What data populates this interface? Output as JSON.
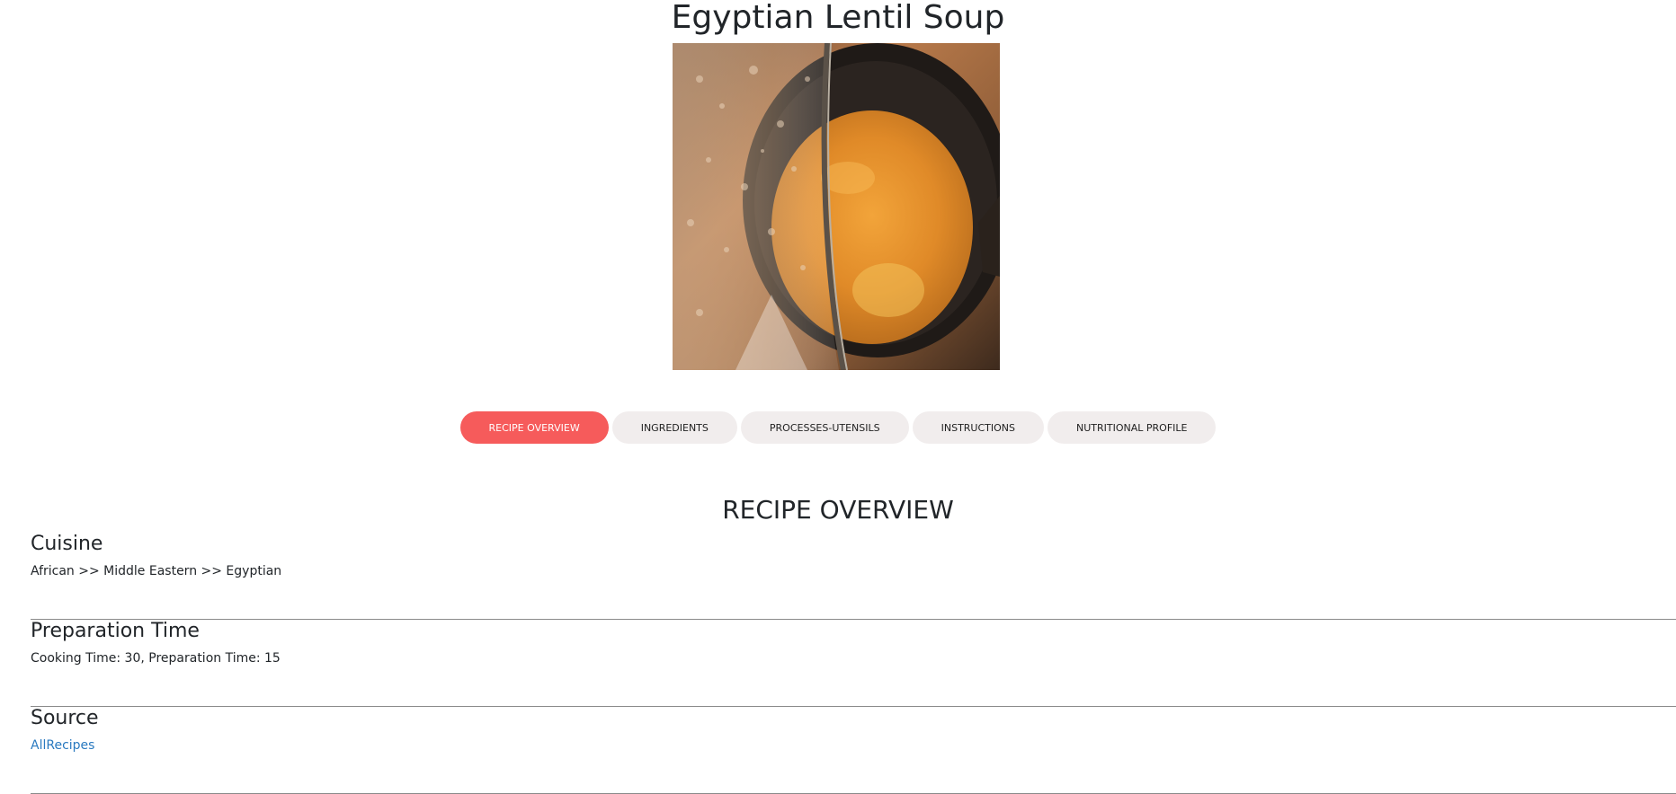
{
  "recipe": {
    "title": "Egyptian Lentil Soup",
    "image_alt": "Egyptian Lentil Soup"
  },
  "tabs": [
    {
      "label": "RECIPE OVERVIEW",
      "active": true
    },
    {
      "label": "INGREDIENTS",
      "active": false
    },
    {
      "label": "PROCESSES-UTENSILS",
      "active": false
    },
    {
      "label": "INSTRUCTIONS",
      "active": false
    },
    {
      "label": "NUTRITIONAL PROFILE",
      "active": false
    }
  ],
  "overview": {
    "title": "RECIPE OVERVIEW",
    "cuisine": {
      "heading": "Cuisine",
      "value": "African >> Middle Eastern >> Egyptian"
    },
    "prep_time": {
      "heading": "Preparation Time",
      "value": "Cooking Time: 30, Preparation Time: 15"
    },
    "source": {
      "heading": "Source",
      "link_text": "AllRecipes"
    }
  },
  "colors": {
    "active_tab": "#f65b5b",
    "inactive_tab": "#f1eded",
    "link": "#2a7ac0"
  }
}
